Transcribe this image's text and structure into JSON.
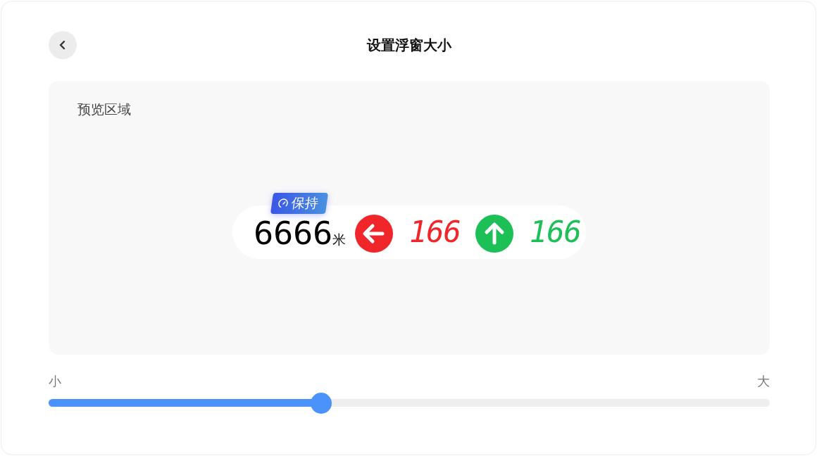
{
  "header": {
    "title": "设置浮窗大小"
  },
  "preview": {
    "label": "预览区域",
    "badge": "保持",
    "distance": "6666",
    "unit": "米",
    "signals": [
      {
        "kind": "left",
        "color": "#f0262a",
        "count": "166"
      },
      {
        "kind": "up",
        "color": "#1dbf57",
        "count": "166"
      }
    ]
  },
  "slider": {
    "min_label": "小",
    "max_label": "大",
    "level": 0.378
  }
}
